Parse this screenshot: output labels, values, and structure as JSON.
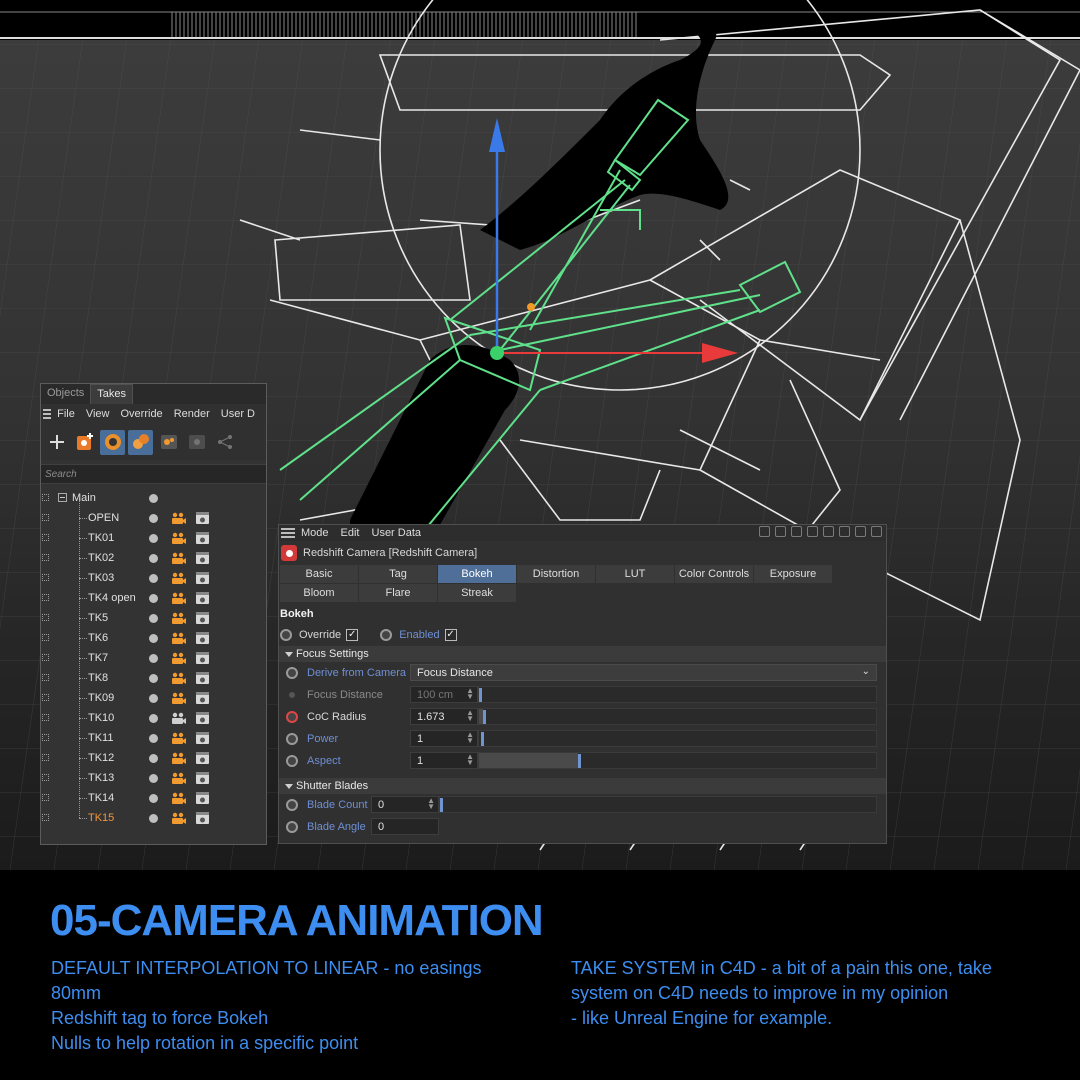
{
  "takes_panel": {
    "tabs": [
      "Objects",
      "Takes"
    ],
    "menu": [
      "File",
      "View",
      "Override",
      "Render",
      "User D"
    ],
    "search_placeholder": "Search",
    "root": "Main",
    "takes": [
      "OPEN",
      "TK01",
      "TK02",
      "TK03",
      "TK4 open",
      "TK5",
      "TK6",
      "TK7",
      "TK8",
      "TK09",
      "TK10",
      "TK11",
      "TK12",
      "TK13",
      "TK14",
      "TK15"
    ],
    "active_take": "TK15"
  },
  "attributes_panel": {
    "menu": [
      "Mode",
      "Edit",
      "User Data"
    ],
    "object_title": "Redshift Camera [Redshift Camera]",
    "tabs_row1": [
      "Basic",
      "Tag",
      "Bokeh",
      "Distortion",
      "LUT",
      "Color Controls",
      "Exposure"
    ],
    "tabs_row2": [
      "Bloom",
      "Flare",
      "Streak"
    ],
    "active_tab": "Bokeh",
    "section_title": "Bokeh",
    "override_label": "Override",
    "override_checked": true,
    "enabled_label": "Enabled",
    "enabled_checked": true,
    "focus_group": "Focus Settings",
    "derive_label": "Derive from Camera",
    "derive_value": "Focus Distance",
    "focus_distance_label": "Focus Distance",
    "focus_distance_value": "100 cm",
    "coc_label": "CoC Radius",
    "coc_value": "1.673",
    "power_label": "Power",
    "power_value": "1",
    "aspect_label": "Aspect",
    "aspect_value": "1",
    "shutter_group": "Shutter Blades",
    "blade_count_label": "Blade Count",
    "blade_count_value": "0",
    "blade_angle_label": "Blade Angle",
    "blade_angle_value": "0"
  },
  "caption": {
    "title": "05-CAMERA ANIMATION",
    "left_lines": [
      "DEFAULT INTERPOLATION TO LINEAR - no easings",
      "80mm",
      "Redshift tag to force Bokeh",
      "Nulls to help rotation in a specific point"
    ],
    "right_lines": [
      "TAKE SYSTEM in C4D - a bit of a pain this one, take",
      "system on C4D needs to improve in my opinion",
      "- like Unreal Engine for example."
    ]
  },
  "colors": {
    "accent_blue": "#3d8ef0",
    "camera_green": "#5fe08a",
    "axis_red": "#e83a3a",
    "axis_blue": "#3a7ae8",
    "take_orange": "#f0963c"
  }
}
